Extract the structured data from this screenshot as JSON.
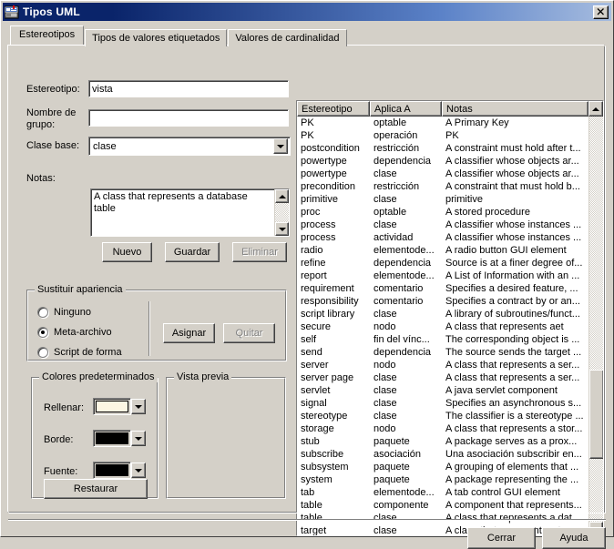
{
  "window": {
    "title": "Tipos UML",
    "icon": "uml-types-icon",
    "close_label": "✕"
  },
  "tabs": [
    {
      "label": "Estereotipos",
      "active": true
    },
    {
      "label": "Tipos de valores etiquetados",
      "active": false
    },
    {
      "label": "Valores de cardinalidad",
      "active": false
    }
  ],
  "form": {
    "stereotype_label": "Estereotipo:",
    "stereotype_value": "vista",
    "group_name_label": "Nombre de grupo:",
    "group_name_value": "",
    "base_class_label": "Clase base:",
    "base_class_value": "clase",
    "notes_label": "Notas:",
    "notes_value": "A class that represents a database table",
    "new_button": "Nuevo",
    "new_button_mnemonic": "N",
    "save_button": "Guardar",
    "save_button_mnemonic": "G",
    "delete_button": "Eliminar",
    "delete_button_mnemonic": "E"
  },
  "appearance": {
    "title": "Sustituir apariencia",
    "options": [
      {
        "label": "Ninguno",
        "selected": false
      },
      {
        "label": "Meta-archivo",
        "selected": true
      },
      {
        "label": "Script de forma",
        "selected": false
      }
    ],
    "assign_button": "Asignar",
    "remove_button": "Quitar"
  },
  "colors": {
    "title": "Colores predeterminados",
    "fill_label": "Rellenar:",
    "fill_color": "#fdf6e3",
    "border_label": "Borde:",
    "border_color": "#000000",
    "font_label": "Fuente:",
    "font_color": "#000000",
    "restore_button": "Restaurar"
  },
  "preview": {
    "title": "Vista previa"
  },
  "list": {
    "columns": [
      "Estereotipo",
      "Aplica A",
      "Notas"
    ],
    "scroll_up_icon": "scroll-up-arrow-icon",
    "scroll_down_icon": "scroll-down-arrow-icon",
    "rows": [
      [
        "PK",
        "optable",
        "A Primary Key"
      ],
      [
        "PK",
        "operación",
        "PK"
      ],
      [
        "postcondition",
        "restricción",
        "A constraint must hold after t..."
      ],
      [
        "powertype",
        "dependencia",
        "A classifier whose objects ar..."
      ],
      [
        "powertype",
        "clase",
        "A classifier whose objects ar..."
      ],
      [
        "precondition",
        "restricción",
        "A constraint that must hold b..."
      ],
      [
        "primitive",
        "clase",
        "primitive"
      ],
      [
        "proc",
        "optable",
        "A stored procedure"
      ],
      [
        "process",
        "clase",
        "A classifier whose instances ..."
      ],
      [
        "process",
        "actividad",
        "A classifier whose instances ..."
      ],
      [
        "radio",
        "elementode...",
        "A radio button GUI element"
      ],
      [
        "refine",
        "dependencia",
        "Source is at a finer degree of..."
      ],
      [
        "report",
        "elementode...",
        "A List of Information with an ..."
      ],
      [
        "requirement",
        "comentario",
        "Specifies a desired feature, ..."
      ],
      [
        "responsibility",
        "comentario",
        "Specifies a contract by or an..."
      ],
      [
        "script library",
        "clase",
        "A library of subroutines/funct..."
      ],
      [
        "secure",
        "nodo",
        "A class that represents aet"
      ],
      [
        "self",
        "fin del vínc...",
        "The corresponding object is ..."
      ],
      [
        "send",
        "dependencia",
        "The source sends the target ..."
      ],
      [
        "server",
        "nodo",
        "A class that represents a ser..."
      ],
      [
        "server page",
        "clase",
        "A class that represents a ser..."
      ],
      [
        "servlet",
        "clase",
        "A java servlet component"
      ],
      [
        "signal",
        "clase",
        "Specifies an asynchronous s..."
      ],
      [
        "stereotype",
        "clase",
        "The classifier is a stereotype ..."
      ],
      [
        "storage",
        "nodo",
        "A class that represents a stor..."
      ],
      [
        "stub",
        "paquete",
        "A package serves as a prox..."
      ],
      [
        "subscribe",
        "asociación",
        "Una asociación subscribir en..."
      ],
      [
        "subsystem",
        "paquete",
        "A grouping of elements that ..."
      ],
      [
        "system",
        "paquete",
        "A package representing the ..."
      ],
      [
        "tab",
        "elementode...",
        "A tab control GUI element"
      ],
      [
        "table",
        "componente",
        "A component that represents..."
      ],
      [
        "table",
        "clase",
        "A class that represents a dat..."
      ],
      [
        "target",
        "clase",
        "A class that represents a tar..."
      ]
    ]
  },
  "footer": {
    "close_button": "Cerrar",
    "help_button": "Ayuda"
  },
  "theme": {
    "face": "#d4d0c8",
    "title_start": "#0a246a",
    "title_end": "#a6bcdf",
    "text": "#000000"
  }
}
